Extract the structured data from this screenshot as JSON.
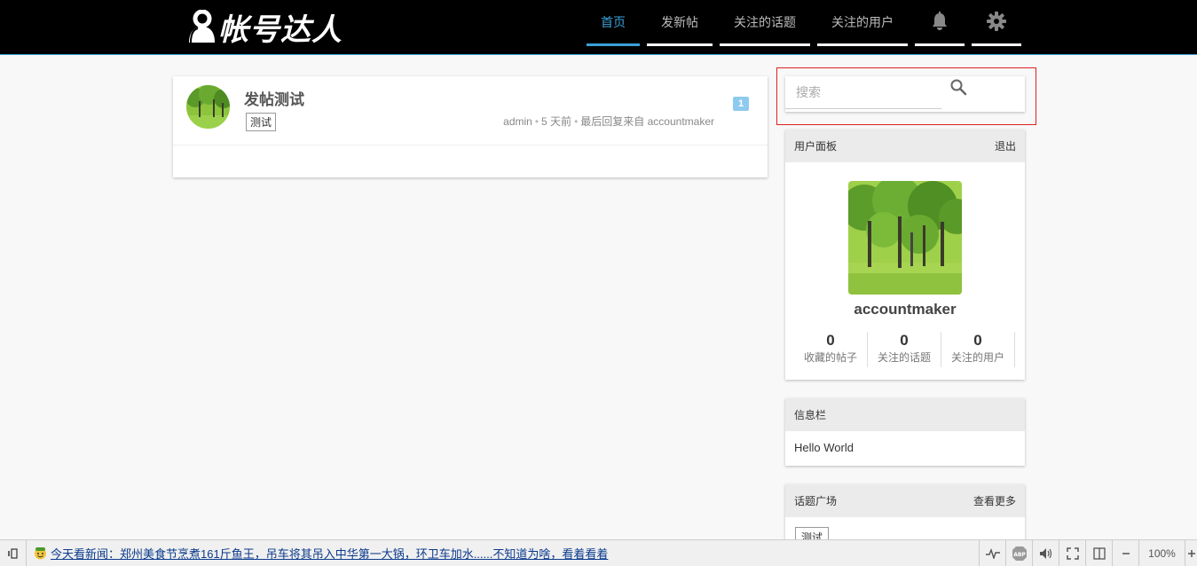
{
  "header": {
    "logo_text": "帐号达人",
    "nav": [
      {
        "label": "首页",
        "active": true
      },
      {
        "label": "发新帖",
        "active": false
      },
      {
        "label": "关注的话题",
        "active": false
      },
      {
        "label": "关注的用户",
        "active": false
      }
    ],
    "nav_icons": [
      "bell-icon",
      "gear-icon"
    ],
    "accent_color": "#3aa0d8"
  },
  "post": {
    "title": "发帖测试",
    "tag": "测试",
    "author": "admin",
    "time": "5 天前",
    "last_reply_prefix": "最后回复来自",
    "last_reply_user": "accountmaker",
    "reply_count": "1"
  },
  "search": {
    "placeholder": "搜索"
  },
  "user_panel": {
    "title": "用户面板",
    "logout": "退出",
    "username": "accountmaker",
    "stats": [
      {
        "value": "0",
        "label": "收藏的帖子"
      },
      {
        "value": "0",
        "label": "关注的话题"
      },
      {
        "value": "0",
        "label": "关注的用户"
      }
    ]
  },
  "info_panel": {
    "title": "信息栏",
    "text": "Hello World"
  },
  "topic_panel": {
    "title": "话题广场",
    "more": "查看更多",
    "tag": "测试"
  },
  "statusbar": {
    "news": "今天看新闻：郑州美食节烹煮161斤鱼王，吊车将其吊入中华第一大锅，环卫车加水......不知道为啥，看着看着",
    "zoom": "100%"
  }
}
